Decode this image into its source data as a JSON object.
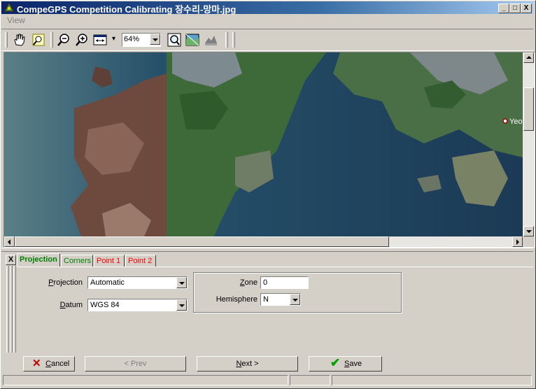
{
  "window": {
    "title": "CompeGPS Competition Calibrating 장수리-망마.jpg",
    "min": "_",
    "max": "□",
    "close": "X"
  },
  "menu": {
    "view": "View"
  },
  "toolbar": {
    "zoom": "64%"
  },
  "map": {
    "place_label": "Yeo"
  },
  "panel": {
    "close": "X",
    "tabs": [
      {
        "label": "Projection",
        "color": "#008000"
      },
      {
        "label": "Corners",
        "color": "#008000"
      },
      {
        "label": "Point 1",
        "color": "#ff0000"
      },
      {
        "label": "Point 2",
        "color": "#ff0000"
      }
    ],
    "projection_label_u": "P",
    "projection_label_rest": "rojection",
    "projection_value": "Automatic",
    "datum_label_u": "D",
    "datum_label_rest": "atum",
    "datum_value": "WGS 84",
    "zone_label_u": "Z",
    "zone_label_rest": "one",
    "zone_value": "0",
    "hemisphere_label": "Hemisphere",
    "hemisphere_value": "N"
  },
  "buttons": {
    "cancel_u": "C",
    "cancel_rest": "ancel",
    "prev": "< Prev",
    "prev_u": "P",
    "next_u": "N",
    "next_rest": "ext >",
    "save_u": "S",
    "save_rest": "ave"
  }
}
